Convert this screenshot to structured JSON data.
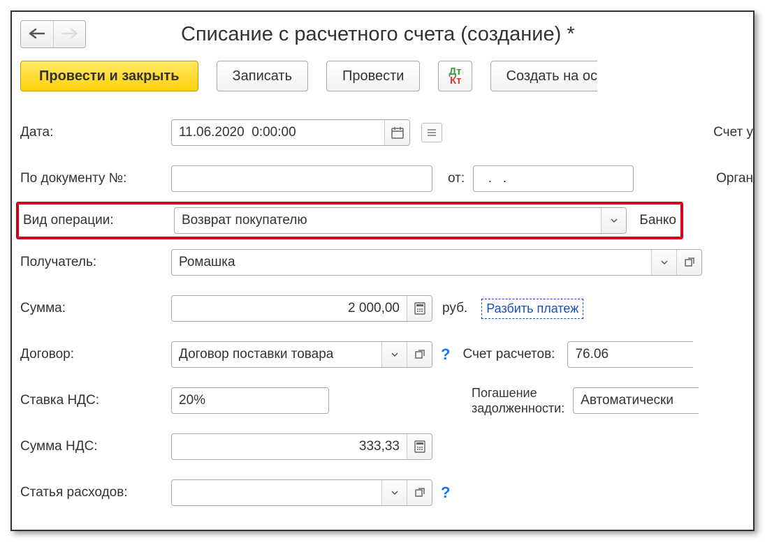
{
  "header": {
    "title": "Списание с расчетного счета (создание) *"
  },
  "toolbar": {
    "post_close": "Провести и закрыть",
    "record": "Записать",
    "post": "Провести",
    "dt": "Дт",
    "kt": "Кт",
    "create_based": "Создать на ос"
  },
  "fields": {
    "date_label": "Дата:",
    "date_value": "11.06.2020  0:00:00",
    "account_label": "Счет у",
    "doc_no_label": "По документу №:",
    "doc_no_value": "",
    "from_label": "от:",
    "from_value": "  .   .",
    "org_label": "Орган",
    "op_type_label": "Вид операции:",
    "op_type_value": "Возврат покупателю",
    "bank_label": "Банко",
    "recipient_label": "Получатель:",
    "recipient_value": "Ромашка",
    "amount_label": "Сумма:",
    "amount_value": "2 000,00",
    "currency": "руб.",
    "split_link": "Разбить платеж",
    "contract_label": "Договор:",
    "contract_value": "Договор поставки товара",
    "settlement_account_label": "Счет расчетов:",
    "settlement_account_value": "76.06",
    "vat_rate_label": "Ставка НДС:",
    "vat_rate_value": "20%",
    "debt_repay_label1": "Погашение",
    "debt_repay_label2": "задолженности:",
    "debt_repay_value": "Автоматически",
    "vat_amount_label": "Сумма НДС:",
    "vat_amount_value": "333,33",
    "expense_label": "Статья расходов:",
    "expense_value": ""
  },
  "icons": {
    "back": "back-arrow-icon",
    "forward": "forward-arrow-icon",
    "calendar": "calendar-icon",
    "calculator": "calculator-icon",
    "dropdown": "chevron-down-icon",
    "open": "open-external-icon",
    "list": "list-icon",
    "help": "help-icon"
  }
}
